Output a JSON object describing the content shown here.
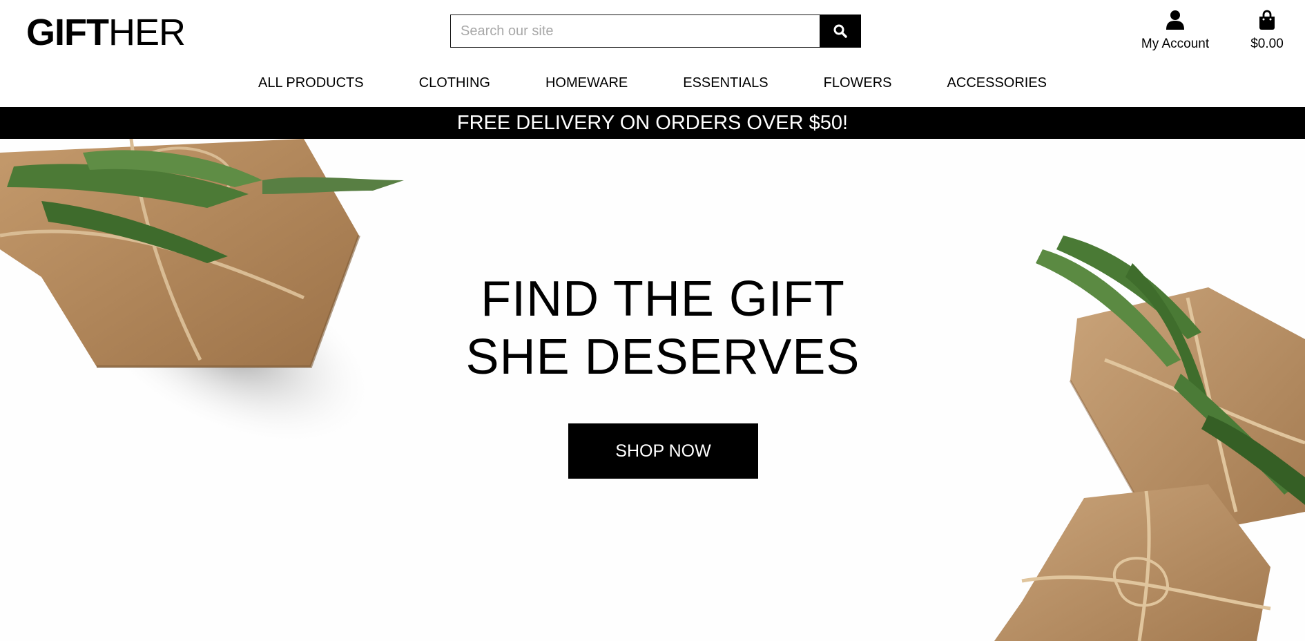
{
  "brand": {
    "logo_bold": "GIFT",
    "logo_light": "HER"
  },
  "search": {
    "placeholder": "Search our site",
    "icon": "search-icon"
  },
  "account": {
    "label": "My Account",
    "icon": "user-icon"
  },
  "bag": {
    "total": "$0.00",
    "icon": "shopping-bag-icon"
  },
  "nav": {
    "items": [
      {
        "label": "ALL PRODUCTS"
      },
      {
        "label": "CLOTHING"
      },
      {
        "label": "HOMEWARE"
      },
      {
        "label": "ESSENTIALS"
      },
      {
        "label": "FLOWERS"
      },
      {
        "label": "ACCESSORIES"
      }
    ]
  },
  "banner": {
    "text": "FREE DELIVERY ON ORDERS OVER $50!"
  },
  "hero": {
    "title_line1": "FIND THE GIFT",
    "title_line2": "SHE DESERVES",
    "cta_label": "SHOP NOW"
  },
  "colors": {
    "primary": "#000000",
    "background": "#ffffff",
    "kraft": "#b38a60",
    "foliage": "#4a7a35"
  }
}
